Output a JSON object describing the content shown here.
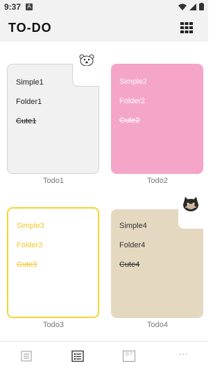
{
  "status": {
    "time": "9:37",
    "notification_letter": "A"
  },
  "app": {
    "title": "TO-DO",
    "view_toggle_icon": "grid-view-icon"
  },
  "cards": [
    {
      "label": "Todo1",
      "items": [
        "Simple1",
        "Folder1",
        "Cute1"
      ],
      "color": "#f1f1f1",
      "decoration": "polar-bear"
    },
    {
      "label": "Todo2",
      "items": [
        "Simple2",
        "Folder2",
        "Cute2"
      ],
      "color": "#f5a5c8"
    },
    {
      "label": "Todo3",
      "items": [
        "Simple3",
        "Folder3",
        "Cute3"
      ],
      "color": "#ffffff",
      "border": "#f4d435"
    },
    {
      "label": "Todo4",
      "items": [
        "Simple4",
        "Folder4",
        "Cute4"
      ],
      "color": "#e4d8c0",
      "decoration": "black-cat"
    }
  ],
  "nav": {
    "items": [
      {
        "icon": "note-icon",
        "active": false
      },
      {
        "icon": "list-icon",
        "active": true
      },
      {
        "icon": "date-icon",
        "text": "D-7",
        "active": false
      },
      {
        "icon": "more-icon",
        "text": "···",
        "active": false
      }
    ]
  }
}
